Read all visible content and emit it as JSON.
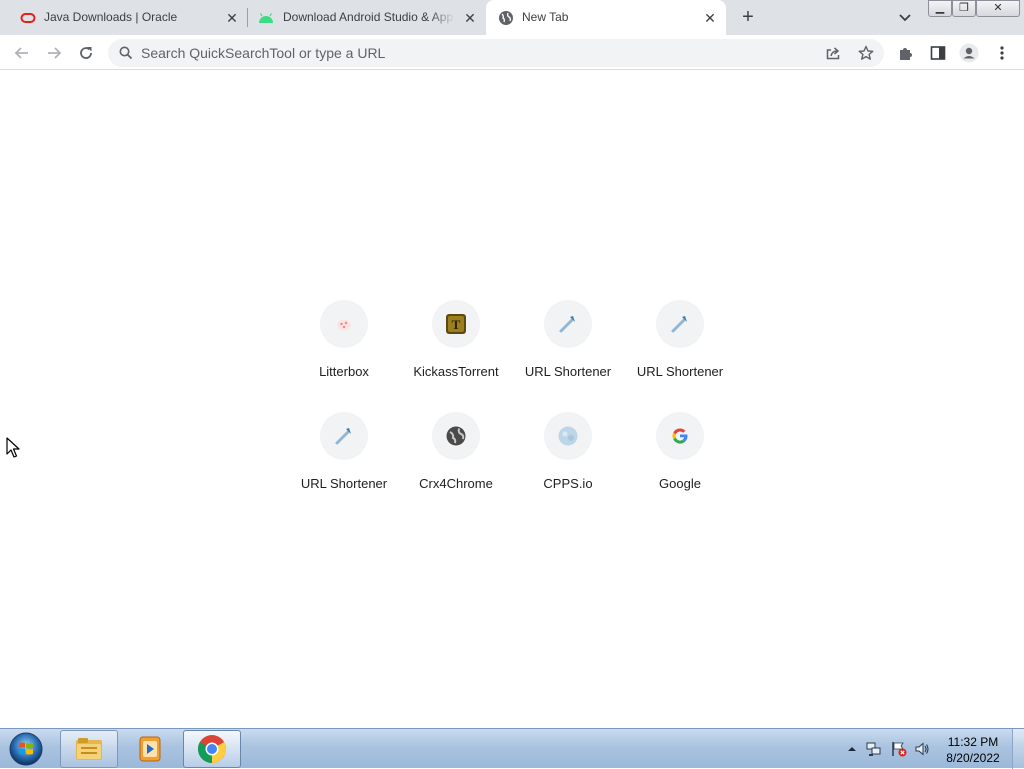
{
  "tabs": [
    {
      "title": "Java Downloads | Oracle",
      "active": false
    },
    {
      "title": "Download Android Studio & App Tools - Android Developers",
      "active": false
    },
    {
      "title": "New Tab",
      "active": true
    }
  ],
  "toolbar": {
    "omnibox_placeholder": "Search QuickSearchTool or type a URL"
  },
  "shortcuts": [
    {
      "label": "Litterbox",
      "icon": "litterbox-icon"
    },
    {
      "label": "KickassTorrent",
      "icon": "kickasstorrent-icon"
    },
    {
      "label": "URL Shortener",
      "icon": "url-shortener-icon"
    },
    {
      "label": "URL Shortener",
      "icon": "url-shortener-icon"
    },
    {
      "label": "URL Shortener",
      "icon": "url-shortener-icon"
    },
    {
      "label": "Crx4Chrome",
      "icon": "crx4chrome-icon"
    },
    {
      "label": "CPPS.io",
      "icon": "cpps-icon"
    },
    {
      "label": "Google",
      "icon": "google-icon"
    }
  ],
  "taskbar": {
    "time": "11:32 PM",
    "date": "8/20/2022",
    "pinned": [
      "windows-explorer-icon",
      "media-player-icon",
      "chrome-icon"
    ]
  },
  "colors": {
    "tabstrip": "#dee1e6",
    "omnibox": "#f1f3f4",
    "oracle_red": "#e2211c",
    "android_green": "#3ddc84"
  }
}
